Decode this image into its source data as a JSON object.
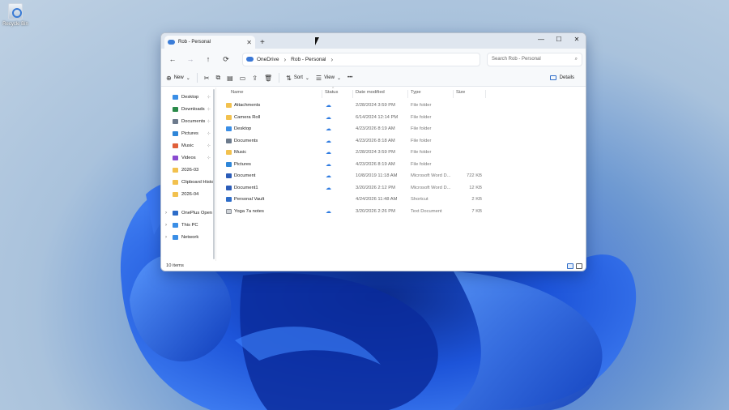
{
  "desktop": {
    "recycle_bin_label": "Recycle Bin"
  },
  "window": {
    "tab_title": "Rob - Personal",
    "new_tab": "+",
    "controls": {
      "minimize": "—",
      "maximize": "☐",
      "close": "✕"
    }
  },
  "nav": {
    "back": "←",
    "forward": "→",
    "up": "↑",
    "refresh": "⟳",
    "breadcrumb": [
      "OneDrive",
      "Rob - Personal"
    ],
    "search_placeholder": "Search Rob - Personal"
  },
  "command_bar": {
    "new_label": "New",
    "sort_label": "Sort",
    "view_label": "View",
    "more_label": "•••",
    "details_label": "Details"
  },
  "sidebar": {
    "quick_access": [
      {
        "label": "Desktop",
        "icon": "desktop-icon",
        "color": "#3a8ee6",
        "pinned": true
      },
      {
        "label": "Downloads",
        "icon": "download-icon",
        "color": "#2a8a4a",
        "pinned": true
      },
      {
        "label": "Documents",
        "icon": "documents-icon",
        "color": "#6c7a8c",
        "pinned": true
      },
      {
        "label": "Pictures",
        "icon": "pictures-icon",
        "color": "#2f86d8",
        "pinned": true
      },
      {
        "label": "Music",
        "icon": "music-icon",
        "color": "#e0603a",
        "pinned": true
      },
      {
        "label": "Videos",
        "icon": "videos-icon",
        "color": "#8a4bd0",
        "pinned": true
      },
      {
        "label": "2026-03",
        "icon": "folder-icon",
        "color": "#f2c14e",
        "pinned": false
      },
      {
        "label": "Clipboard Histo",
        "icon": "folder-icon",
        "color": "#f2c14e",
        "pinned": false
      },
      {
        "label": "2026-04",
        "icon": "folder-icon",
        "color": "#f2c14e",
        "pinned": false
      }
    ],
    "devices": [
      {
        "label": "OnePlus Open",
        "icon": "phone-icon",
        "color": "#2d6cc8"
      },
      {
        "label": "This PC",
        "icon": "pc-icon",
        "color": "#3a8ee6"
      },
      {
        "label": "Network",
        "icon": "network-icon",
        "color": "#3a8ee6"
      }
    ],
    "pin_glyph": "📌",
    "chevron": "›"
  },
  "columns": {
    "name": "Name",
    "status": "Status",
    "date": "Date modified",
    "type": "Type",
    "size": "Size"
  },
  "files": [
    {
      "name": "Attachments",
      "icon": "folder-icon",
      "color": "#f2c14e",
      "status": "cloud",
      "date": "2/28/2024 3:59 PM",
      "type": "File folder",
      "size": ""
    },
    {
      "name": "Camera Roll",
      "icon": "folder-icon",
      "color": "#f2c14e",
      "status": "cloud",
      "date": "6/14/2024 12:14 PM",
      "type": "File folder",
      "size": ""
    },
    {
      "name": "Desktop",
      "icon": "desktop-icon",
      "color": "#3a8ee6",
      "status": "cloud",
      "date": "4/23/2026 8:19 AM",
      "type": "File folder",
      "size": ""
    },
    {
      "name": "Documents",
      "icon": "documents-icon",
      "color": "#6c7a8c",
      "status": "cloud",
      "date": "4/23/2026 8:18 AM",
      "type": "File folder",
      "size": ""
    },
    {
      "name": "Music",
      "icon": "folder-icon",
      "color": "#f2c14e",
      "status": "cloud",
      "date": "2/28/2024 3:59 PM",
      "type": "File folder",
      "size": ""
    },
    {
      "name": "Pictures",
      "icon": "pictures-icon",
      "color": "#2f86d8",
      "status": "cloud",
      "date": "4/23/2026 8:19 AM",
      "type": "File folder",
      "size": ""
    },
    {
      "name": "Document",
      "icon": "word-icon",
      "color": "#2b5cb8",
      "status": "cloud",
      "date": "10/8/2019 11:18 AM",
      "type": "Microsoft Word D...",
      "size": "722 KB"
    },
    {
      "name": "Document1",
      "icon": "word-icon",
      "color": "#2b5cb8",
      "status": "cloud",
      "date": "3/20/2026 2:12 PM",
      "type": "Microsoft Word D...",
      "size": "12 KB"
    },
    {
      "name": "Personal Vault",
      "icon": "vault-icon",
      "color": "#2d6cc8",
      "status": "",
      "date": "4/24/2026 11:48 AM",
      "type": "Shortcut",
      "size": "2 KB"
    },
    {
      "name": "Yoga 7a notes",
      "icon": "text-icon",
      "color": "#8a8f96",
      "status": "cloud",
      "date": "3/20/2026 2:26 PM",
      "type": "Text Document",
      "size": "7 KB"
    }
  ],
  "status_bar": {
    "item_count": "10 items"
  },
  "colors": {
    "accent": "#2d6cc8",
    "cloud": "#2f7be0"
  }
}
